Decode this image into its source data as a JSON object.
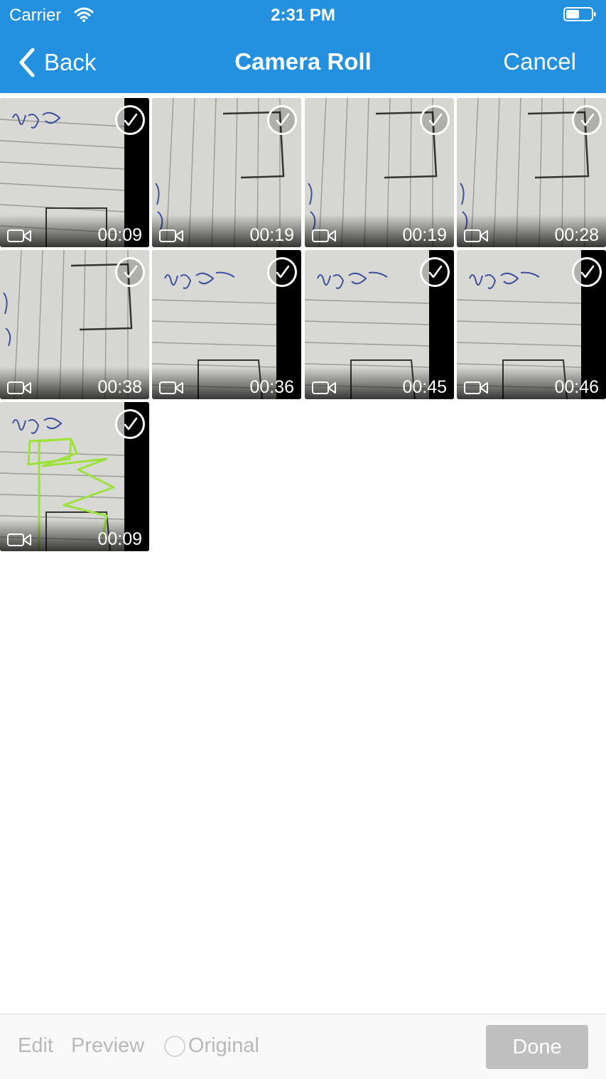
{
  "status_bar": {
    "carrier": "Carrier",
    "time": "2:31 PM"
  },
  "nav": {
    "back_label": "Back",
    "title": "Camera Roll",
    "cancel_label": "Cancel"
  },
  "videos": [
    {
      "duration": "00:09",
      "selected": true
    },
    {
      "duration": "00:19",
      "selected": true
    },
    {
      "duration": "00:19",
      "selected": true
    },
    {
      "duration": "00:28",
      "selected": true
    },
    {
      "duration": "00:38",
      "selected": true
    },
    {
      "duration": "00:36",
      "selected": true
    },
    {
      "duration": "00:45",
      "selected": true
    },
    {
      "duration": "00:46",
      "selected": true
    },
    {
      "duration": "00:09",
      "selected": true
    }
  ],
  "toolbar": {
    "edit_label": "Edit",
    "preview_label": "Preview",
    "original_label": "Original",
    "done_label": "Done"
  },
  "colors": {
    "nav_background": "#2390e0",
    "done_disabled": "#bfbfbf",
    "toolbar_text_disabled": "#b8b8bd"
  }
}
